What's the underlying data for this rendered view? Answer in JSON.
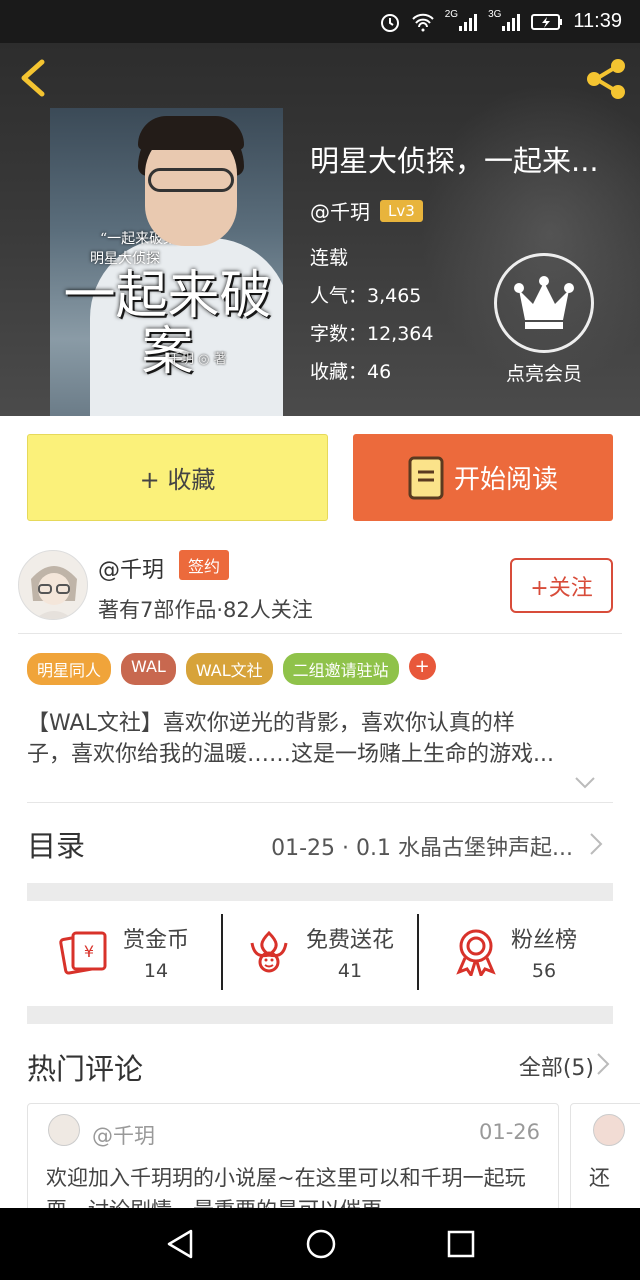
{
  "status_bar": {
    "network_1": "2G",
    "network_2": "3G",
    "time": "11:39"
  },
  "book": {
    "title": "明星大侦探，一起来...",
    "author": "@千玥",
    "level": "Lv3",
    "status": "连载",
    "popularity": "人气：3,465",
    "word_count": "字数：12,364",
    "favorites": "收藏：46",
    "vip_label": "点亮会员",
    "cover": {
      "small_title": "“一起来破案”",
      "series": "明星大侦探",
      "big_title": "一起来破案",
      "byline": "千玥 ◎ 著"
    }
  },
  "actions": {
    "collect_label": "+ 收藏",
    "read_label": "开始阅读"
  },
  "author_block": {
    "name": "@千玥",
    "badge": "签约",
    "stats": "著有7部作品·82人关注",
    "follow_label": "+关注"
  },
  "tags": [
    {
      "label": "明星同人",
      "color": "#f0a43a"
    },
    {
      "label": "WAL",
      "color": "#c8684f"
    },
    {
      "label": "WAL文社",
      "color": "#d7a33a"
    },
    {
      "label": "二组邀请驻站",
      "color": "#8fc24a"
    }
  ],
  "tag_plus": "+",
  "description": {
    "line1": "【WAL文社】喜欢你逆光的背影，喜欢你认真的样",
    "line2": "子，喜欢你给我的温暖……这是一场赌上生命的游戏..."
  },
  "toc": {
    "label": "目录",
    "latest": "01-25 · 0.1 水晶古堡钟声起..."
  },
  "stats": [
    {
      "label": "赏金币",
      "value": "14",
      "icon": "red-envelope-icon"
    },
    {
      "label": "免费送花",
      "value": "41",
      "icon": "flower-icon"
    },
    {
      "label": "粉丝榜",
      "value": "56",
      "icon": "medal-icon"
    }
  ],
  "hot_comments": {
    "title": "热门评论",
    "all_label": "全部(5)",
    "items": [
      {
        "user": "@千玥",
        "date": "01-26",
        "text": "欢迎加入千玥玥的小说屋~在这里可以和千玥一起玩耍，讨论剧情，最重要的是可以催更~"
      },
      {
        "user": "",
        "date": "",
        "text": "还"
      }
    ]
  },
  "colors": {
    "accent_orange": "#ec6a3c",
    "collect_yellow": "#fbf17a",
    "follow_red": "#d84c3a",
    "level_gold": "#e8b43c"
  }
}
